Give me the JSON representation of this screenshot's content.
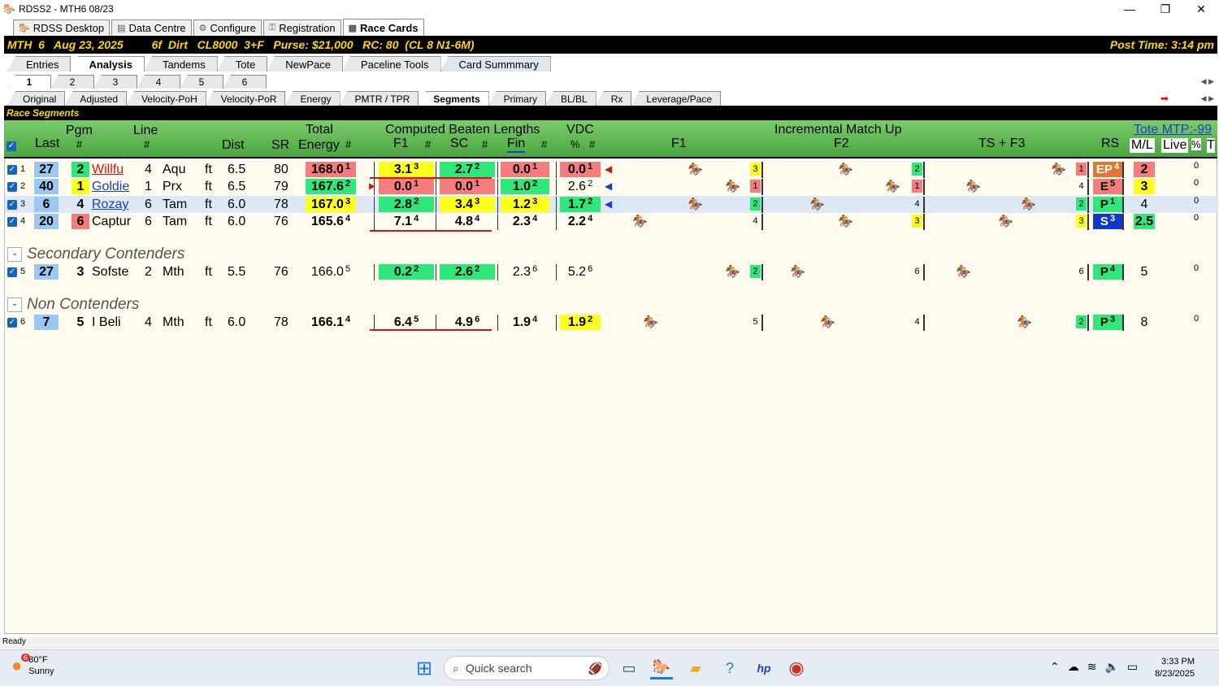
{
  "window": {
    "title": "RDSS2 - MTH6  08/23"
  },
  "main_tabs": [
    {
      "label": "RDSS Desktop",
      "icon": "horse-icon"
    },
    {
      "label": "Data Centre",
      "icon": "database-icon"
    },
    {
      "label": "Configure",
      "icon": "gear-icon"
    },
    {
      "label": "Registration",
      "icon": "key-icon"
    },
    {
      "label": "Race Cards",
      "icon": "card-icon"
    }
  ],
  "race_bar": {
    "info": "MTH  6   Aug 23, 2025         6f  Dirt   CL8000  3+F   Purse: $21,000   RC: 80  (CL 8 N1-6M)",
    "post_time": "Post Time: 3:14 pm"
  },
  "tabs_level1": [
    "Entries",
    "Analysis",
    "Tandems",
    "Tote",
    "NewPace",
    "Paceline Tools",
    "Card Summmary"
  ],
  "tabs_level2": [
    "1",
    "2",
    "3",
    "4",
    "5",
    "6"
  ],
  "tabs_level3": [
    "Original",
    "Adjusted",
    "Velocity-PoH",
    "Velocity-PoR",
    "Energy",
    "PMTR / TPR",
    "Segments",
    "Primary",
    "BL/BL",
    "Rx",
    "Leverage/Pace"
  ],
  "segments_title": "Race Segments",
  "headers": {
    "pgm": "Pgm",
    "pgm_num": "#",
    "line": "Line",
    "line_num": "#",
    "last": "Last",
    "dist": "Dist",
    "sr": "SR",
    "total": "Total",
    "energy": "Energy",
    "energy_num": "#",
    "cbl": "Computed Beaten Lengths",
    "f1": "F1",
    "f1_num": "#",
    "sc": "SC",
    "sc_num": "#",
    "fin": "Fin",
    "fin_num": "#",
    "vdc": "VDC",
    "vdc_pct": "%",
    "vdc_num": "#",
    "imu": "Incremental Match Up",
    "imu_f1": "F1",
    "imu_f2": "F2",
    "imu_ts": "TS + F3",
    "rs": "RS",
    "ml": "M/L",
    "live": "Live",
    "pct": "%",
    "t": "T",
    "tote_mtp": "Tote MTP:-99"
  },
  "rows": [
    {
      "idx": "1",
      "last": "27",
      "pgm": "2",
      "pgm_color": "#2ee87a",
      "name": "Willfu",
      "name_style": "red-link",
      "line": "4",
      "track": "Aqu",
      "surf": "ft",
      "dist": "6.5",
      "sr": "80",
      "energy": "168.0",
      "energy_rank": "1",
      "f1": "3.1",
      "f1_r": "3",
      "sc": "2.7",
      "sc_r": "2",
      "fin": "0.0",
      "fin_r": "1",
      "vdc": "0.0",
      "vdc_r": "1",
      "m1": "3",
      "m2": "2",
      "m3": "1",
      "rs": "EP",
      "rs_r": "4",
      "ml": "2",
      "live": "0"
    },
    {
      "idx": "2",
      "last": "40",
      "pgm": "1",
      "pgm_color": "#ffff1e",
      "name": "Goldie",
      "name_style": "blue-link",
      "line": "1",
      "track": "Prx",
      "surf": "ft",
      "dist": "6.5",
      "sr": "79",
      "energy": "167.6",
      "energy_rank": "2",
      "f1": "0.0",
      "f1_r": "1",
      "sc": "0.0",
      "sc_r": "1",
      "fin": "1.0",
      "fin_r": "2",
      "vdc": "2.6",
      "vdc_r": "2",
      "m1": "1",
      "m2": "1",
      "m3": "4",
      "rs": "E",
      "rs_r": "5",
      "ml": "3",
      "live": "0"
    },
    {
      "idx": "3",
      "last": "6",
      "pgm": "4",
      "pgm_color": "",
      "name": "Rozay",
      "name_style": "blue-link",
      "line": "6",
      "track": "Tam",
      "surf": "ft",
      "dist": "6.0",
      "sr": "78",
      "energy": "167.0",
      "energy_rank": "3",
      "f1": "2.8",
      "f1_r": "2",
      "sc": "3.4",
      "sc_r": "3",
      "fin": "1.2",
      "fin_r": "3",
      "vdc": "1.7",
      "vdc_r": "2",
      "m1": "2",
      "m2": "4",
      "m3": "2",
      "rs": "P",
      "rs_r": "1",
      "ml": "4",
      "live": "0"
    },
    {
      "idx": "4",
      "last": "20",
      "pgm": "6",
      "pgm_color": "#f47c7c",
      "name": "Captur",
      "name_style": "plain",
      "line": "6",
      "track": "Tam",
      "surf": "ft",
      "dist": "6.0",
      "sr": "76",
      "energy": "165.6",
      "energy_rank": "4",
      "f1": "7.1",
      "f1_r": "4",
      "sc": "4.8",
      "sc_r": "4",
      "fin": "2.3",
      "fin_r": "4",
      "vdc": "2.2",
      "vdc_r": "4",
      "m1": "4",
      "m2": "3",
      "m3": "3",
      "rs": "S",
      "rs_r": "3",
      "ml": "2.5",
      "live": "0"
    }
  ],
  "section_secondary": "Secondary Contenders",
  "row5": {
    "idx": "5",
    "last": "27",
    "pgm": "3",
    "name": "Sofste",
    "line": "2",
    "track": "Mth",
    "surf": "ft",
    "dist": "5.5",
    "sr": "76",
    "energy": "166.0",
    "energy_rank": "5",
    "f1": "0.2",
    "f1_r": "2",
    "sc": "2.6",
    "sc_r": "2",
    "fin": "2.3",
    "fin_r": "6",
    "vdc": "5.2",
    "vdc_r": "6",
    "m1": "2",
    "m2": "6",
    "m3": "6",
    "rs": "P",
    "rs_r": "4",
    "ml": "5",
    "live": "0"
  },
  "section_non": "Non Contenders",
  "row6": {
    "idx": "6",
    "last": "7",
    "pgm": "5",
    "name": "I Beli",
    "line": "4",
    "track": "Mth",
    "surf": "ft",
    "dist": "6.0",
    "sr": "78",
    "energy": "166.1",
    "energy_rank": "4",
    "f1": "6.4",
    "f1_r": "5",
    "sc": "4.9",
    "sc_r": "6",
    "fin": "1.9",
    "fin_r": "4",
    "vdc": "1.9",
    "vdc_r": "2",
    "m1": "5",
    "m2": "4",
    "m3": "2",
    "rs": "P",
    "rs_r": "3",
    "ml": "8",
    "live": "0"
  },
  "status": "Ready",
  "taskbar": {
    "temp": "80°F",
    "weather": "Sunny",
    "weather_badge": "6",
    "search_placeholder": "Quick search",
    "time": "3:33 PM",
    "date": "8/23/2025"
  }
}
